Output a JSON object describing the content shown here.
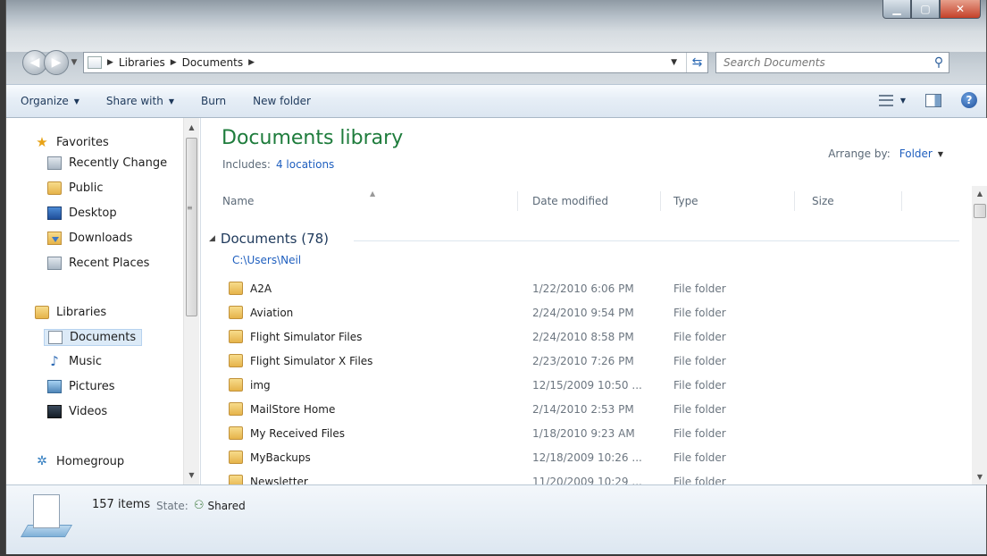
{
  "address": {
    "crumbs": [
      "Libraries",
      "Documents"
    ],
    "search_placeholder": "Search Documents"
  },
  "toolbar": {
    "organize": "Organize",
    "share_with": "Share with",
    "burn": "Burn",
    "new_folder": "New folder"
  },
  "nav": {
    "favorites": "Favorites",
    "recently_changed": "Recently Change",
    "public": "Public",
    "desktop": "Desktop",
    "downloads": "Downloads",
    "recent_places": "Recent Places",
    "libraries": "Libraries",
    "documents": "Documents",
    "music": "Music",
    "pictures": "Pictures",
    "videos": "Videos",
    "homegroup": "Homegroup"
  },
  "library": {
    "title": "Documents library",
    "includes_label": "Includes:",
    "includes_link": "4 locations",
    "arrange_label": "Arrange by:",
    "arrange_value": "Folder"
  },
  "columns": {
    "name": "Name",
    "date": "Date modified",
    "type": "Type",
    "size": "Size"
  },
  "group": {
    "title": "Documents (78)",
    "path": "C:\\Users\\Neil"
  },
  "files": [
    {
      "name": "A2A",
      "date": "1/22/2010 6:06 PM",
      "type": "File folder"
    },
    {
      "name": "Aviation",
      "date": "2/24/2010 9:54 PM",
      "type": "File folder"
    },
    {
      "name": "Flight Simulator Files",
      "date": "2/24/2010 8:58 PM",
      "type": "File folder"
    },
    {
      "name": "Flight Simulator X Files",
      "date": "2/23/2010 7:26 PM",
      "type": "File folder"
    },
    {
      "name": "img",
      "date": "12/15/2009 10:50 ...",
      "type": "File folder"
    },
    {
      "name": "MailStore Home",
      "date": "2/14/2010 2:53 PM",
      "type": "File folder"
    },
    {
      "name": "My Received Files",
      "date": "1/18/2010 9:23 AM",
      "type": "File folder"
    },
    {
      "name": "MyBackups",
      "date": "12/18/2009 10:26 ...",
      "type": "File folder"
    },
    {
      "name": "Newsletter",
      "date": "11/20/2009 10:29 ...",
      "type": "File folder"
    }
  ],
  "details": {
    "count": "157 items",
    "state_label": "State:",
    "state_value": "Shared"
  }
}
